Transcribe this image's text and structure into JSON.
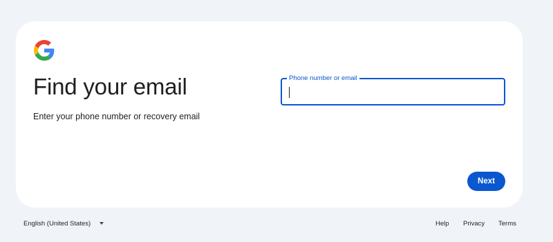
{
  "logo": {
    "icon": "google-g-icon",
    "colors": {
      "blue": "#4285F4",
      "red": "#EA4335",
      "yellow": "#FBBC05",
      "green": "#34A853"
    }
  },
  "heading": "Find your email",
  "subtitle": "Enter your phone number or recovery email",
  "field": {
    "label": "Phone number or email",
    "value": ""
  },
  "next_button": "Next",
  "footer": {
    "language": "English (United States)",
    "language_icon": "caret-down-icon",
    "links": {
      "help": "Help",
      "privacy": "Privacy",
      "terms": "Terms"
    }
  },
  "colors": {
    "accent": "#0b57d0",
    "page_bg": "#f0f4f9",
    "card_bg": "#ffffff"
  }
}
